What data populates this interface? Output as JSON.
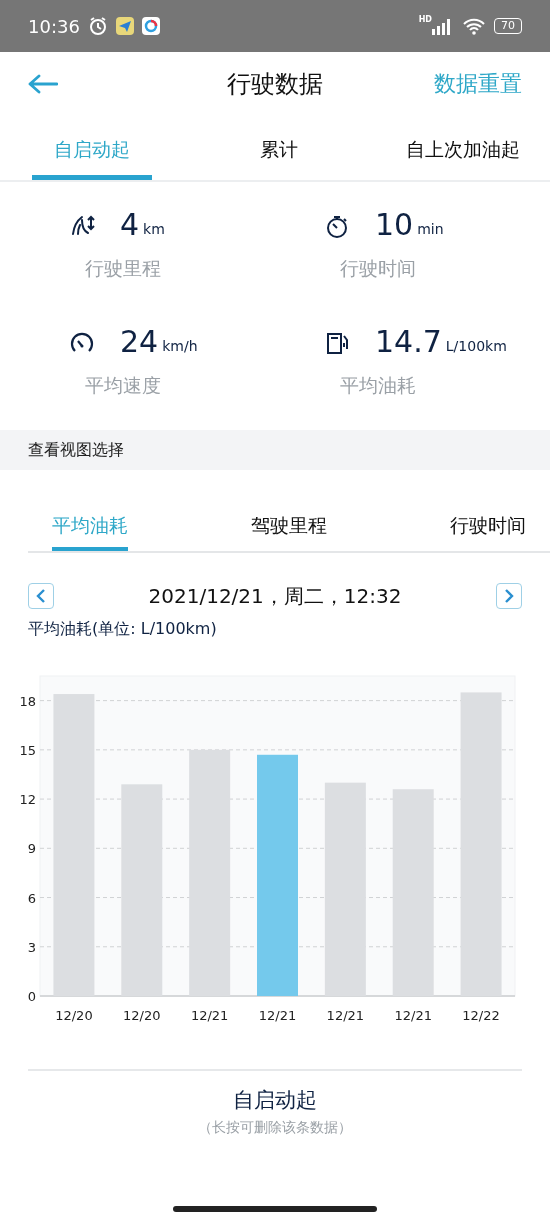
{
  "status_bar": {
    "time": "10:36",
    "network": "HD",
    "battery": "70"
  },
  "header": {
    "title": "行驶数据",
    "action": "数据重置"
  },
  "tabs": [
    {
      "label": "自启动起",
      "selected": true
    },
    {
      "label": "累计",
      "selected": false
    },
    {
      "label": "自上次加油起",
      "selected": false
    }
  ],
  "stats": [
    {
      "kind": "distance",
      "value": "4",
      "unit": "km",
      "label": "行驶里程"
    },
    {
      "kind": "time",
      "value": "10",
      "unit": "min",
      "label": "行驶时间"
    },
    {
      "kind": "speed",
      "value": "24",
      "unit": "km/h",
      "label": "平均速度"
    },
    {
      "kind": "fuel",
      "value": "14.7",
      "unit": "L/100km",
      "label": "平均油耗"
    }
  ],
  "section_title": "查看视图选择",
  "view_tabs": [
    {
      "label": "平均油耗",
      "selected": true
    },
    {
      "label": "驾驶里程",
      "selected": false
    },
    {
      "label": "行驶时间",
      "selected": false
    }
  ],
  "date": "2021/12/21，周二，12:32",
  "chart": {
    "unit_label": "平均油耗(单位: L/100km)",
    "chart_data": {
      "type": "bar",
      "stacked": true,
      "categories": [
        "12/20",
        "12/20",
        "12/21",
        "12/21",
        "12/21",
        "12/21",
        "12/22"
      ],
      "grid": true,
      "ylim": [
        0,
        19.5
      ],
      "yticks": [
        0,
        3,
        6,
        9,
        12,
        15,
        18
      ],
      "series": [
        {
          "color": "#dcdee1",
          "values": [
            18.4,
            12.9,
            15.0,
            null,
            13.0,
            12.6,
            18.5
          ]
        },
        {
          "color": "#74c9ec",
          "values": [
            null,
            null,
            null,
            14.7,
            null,
            null,
            null
          ]
        }
      ]
    }
  },
  "footer": {
    "title": "自启动起",
    "hint": "（长按可删除该条数据）"
  }
}
